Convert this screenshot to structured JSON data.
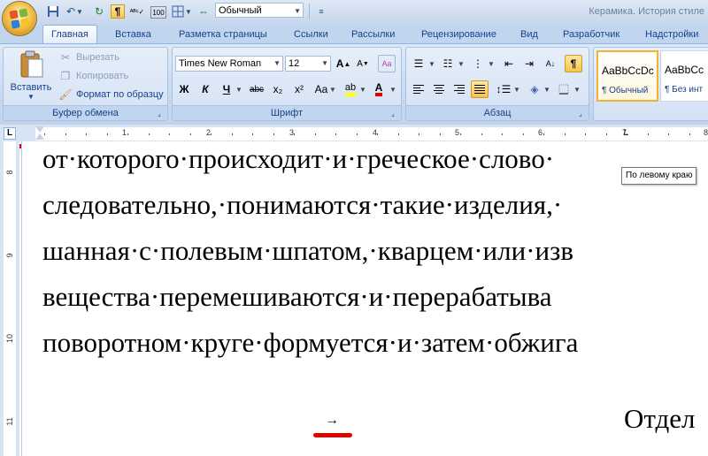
{
  "window": {
    "title": "Керамика. История стиле"
  },
  "colors": {
    "accent_red": "#e00000",
    "selected_style_border": "#f2b233",
    "ribbon_bg": "#c9dbf1"
  },
  "quick_access": {
    "icons": [
      "save-icon",
      "undo-icon",
      "redo-icon",
      "pilcrow-icon",
      "spelling-icon",
      "counter-icon",
      "layout-icon",
      "arrows-icon"
    ],
    "style_value": "Обычный"
  },
  "tabs": [
    "Главная",
    "Вставка",
    "Разметка страницы",
    "Ссылки",
    "Рассылки",
    "Рецензирование",
    "Вид",
    "Разработчик",
    "Надстройки"
  ],
  "clipboard": {
    "paste_label": "Вставить",
    "cut_label": "Вырезать",
    "copy_label": "Копировать",
    "format_painter_label": "Формат по образцу",
    "group_label": "Буфер обмена"
  },
  "font": {
    "font_name": "Times New Roman",
    "font_size": "12",
    "bold": "Ж",
    "italic": "К",
    "underline": "Ч",
    "strike": "abc",
    "subscript": "x₂",
    "superscript": "x²",
    "case": "Aa",
    "grow": "A",
    "shrink": "A",
    "group_label": "Шрифт"
  },
  "paragraph": {
    "group_label": "Абзац"
  },
  "styles": [
    {
      "sample": "AaBbCcDc",
      "name": "¶ Обычный"
    },
    {
      "sample": "AaBbCc",
      "name": "¶ Без инт"
    }
  ],
  "ruler": {
    "h_numbers": [
      "1",
      "2",
      "3",
      "4",
      "5",
      "6",
      "7",
      "8"
    ],
    "v_numbers": [
      "8",
      "9",
      "10",
      "11"
    ],
    "corner_symbol": "L"
  },
  "document": {
    "lines": [
      "от·которого·происходит·и·греческое·слово·",
      "следовательно,·понимаются·такие·изделия,·",
      "шанная·с·полевым·шпатом,·кварцем·или·изв",
      "вещества·перемешиваются·и·перерабатыва",
      "поворотном·круге·формуется·и·затем·обжига"
    ],
    "tab_arrow": "→",
    "tail_word": "Отдел"
  },
  "tooltip": "По левому краю"
}
